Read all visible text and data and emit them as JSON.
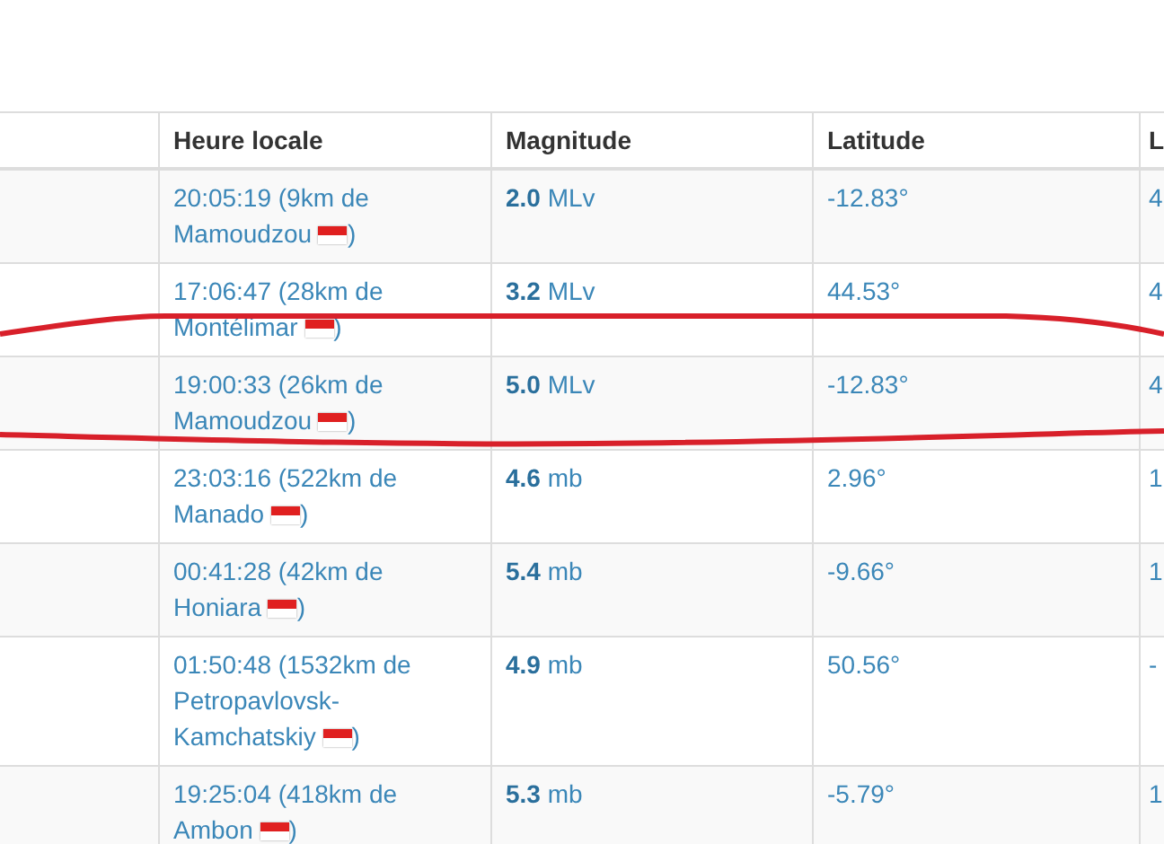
{
  "table": {
    "columns": [
      "",
      "Heure locale",
      "Magnitude",
      "Latitude",
      "L"
    ],
    "rows": [
      {
        "place": [
          "20:05:19 (9km de Mamoudzou",
          ")"
        ],
        "magnitude": "**2.0** MLv",
        "latitude": "-12.83°",
        "column_5": "4",
        "circled": false
      },
      {
        "place": [
          "17:06:47 (28km de Montélimar",
          ")"
        ],
        "magnitude": "**3.2** MLv",
        "latitude": "44.53°",
        "column_5": "4",
        "circled": false
      },
      {
        "place": [
          "19:00:33 (26km de Mamoudzou",
          ")"
        ],
        "magnitude": "**5.0** MLv",
        "latitude": "-12.83°",
        "column_5": "4",
        "circled": true
      },
      {
        "place": [
          "23:03:16 (522km de Manado",
          ")"
        ],
        "magnitude": "**4.6** mb",
        "latitude": "2.96°",
        "column_5": "1",
        "circled": false
      },
      {
        "place": [
          "00:41:28 (42km de Honiara",
          ")"
        ],
        "magnitude": "**5.4** mb",
        "latitude": "-9.66°",
        "column_5": "1",
        "circled": false
      },
      {
        "place": [
          "01:50:48 (1532km de Petropavlovsk-Kamchatskiy",
          ")"
        ],
        "magnitude": "**4.9** mb",
        "latitude": "50.56°",
        "column_5": "-",
        "circled": false
      },
      {
        "place": [
          "19:25:04 (418km de Ambon",
          ")"
        ],
        "magnitude": "**5.3** mb",
        "latitude": "-5.79°",
        "column_5": "1",
        "circled": false
      }
    ]
  }
}
